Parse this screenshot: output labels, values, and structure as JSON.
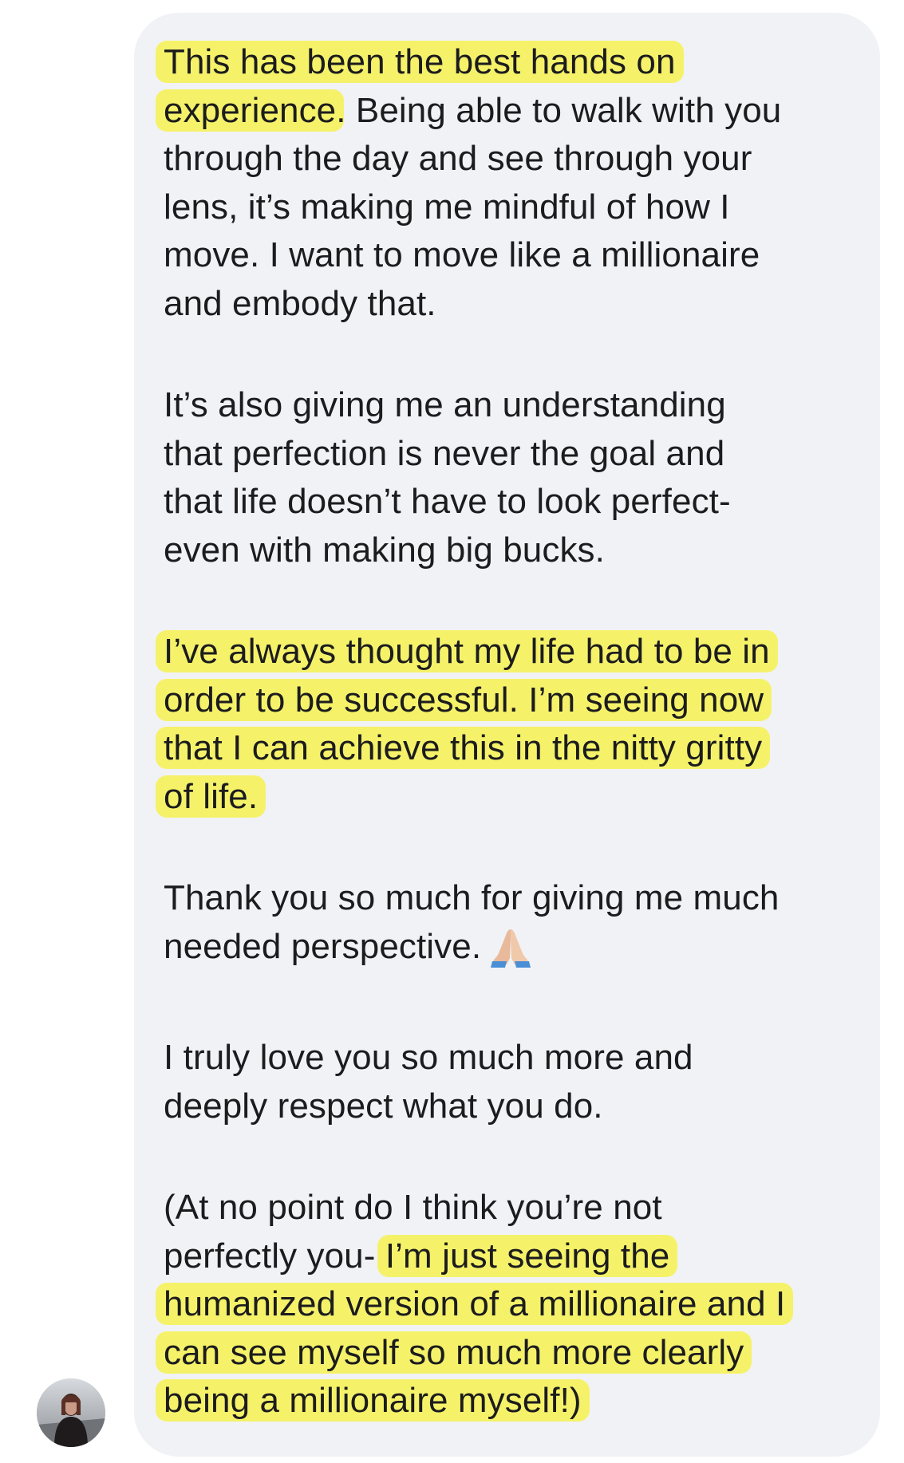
{
  "conversation": {
    "message": {
      "paragraphs": [
        {
          "lines": [
            {
              "segments": [
                {
                  "text": "This has been the best hands on",
                  "highlight": true
                }
              ]
            },
            {
              "segments": [
                {
                  "text": "experience",
                  "highlight": true
                },
                {
                  "text": ". Being able to walk with you",
                  "highlight": false
                }
              ]
            },
            {
              "segments": [
                {
                  "text": "through the day and see through your",
                  "highlight": false
                }
              ]
            },
            {
              "segments": [
                {
                  "text": "lens, it’s making me mindful of how I",
                  "highlight": false
                }
              ]
            },
            {
              "segments": [
                {
                  "text": "move. I want to move like a millionaire",
                  "highlight": false
                }
              ]
            },
            {
              "segments": [
                {
                  "text": "and embody that.",
                  "highlight": false
                }
              ]
            }
          ]
        },
        {
          "lines": [
            {
              "segments": [
                {
                  "text": "It’s also giving me an understanding",
                  "highlight": false
                }
              ]
            },
            {
              "segments": [
                {
                  "text": "that perfection is never the goal and",
                  "highlight": false
                }
              ]
            },
            {
              "segments": [
                {
                  "text": "that life doesn’t have to look perfect-",
                  "highlight": false
                }
              ]
            },
            {
              "segments": [
                {
                  "text": "even with making big bucks.",
                  "highlight": false
                }
              ]
            }
          ]
        },
        {
          "lines": [
            {
              "segments": [
                {
                  "text": "I’ve always thought my life had to be in",
                  "highlight": true
                }
              ]
            },
            {
              "segments": [
                {
                  "text": "order to be successful. I’m seeing now",
                  "highlight": true
                }
              ]
            },
            {
              "segments": [
                {
                  "text": "that I can achieve this in the nitty gritty",
                  "highlight": true
                }
              ]
            },
            {
              "segments": [
                {
                  "text": "of life.",
                  "highlight": true
                }
              ]
            }
          ]
        },
        {
          "lines": [
            {
              "segments": [
                {
                  "text": "Thank you so much for giving me much",
                  "highlight": false
                }
              ]
            },
            {
              "segments": [
                {
                  "text": "needed perspective.",
                  "highlight": false
                }
              ],
              "emoji": "folded-hands-icon"
            }
          ]
        },
        {
          "lines": [
            {
              "segments": [
                {
                  "text": "I truly love you so much more and",
                  "highlight": false
                }
              ]
            },
            {
              "segments": [
                {
                  "text": "deeply respect what you do.",
                  "highlight": false
                }
              ]
            }
          ]
        },
        {
          "lines": [
            {
              "segments": [
                {
                  "text": "(At no point do I think you’re not",
                  "highlight": false
                }
              ]
            },
            {
              "segments": [
                {
                  "text": "perfectly you- ",
                  "highlight": false
                },
                {
                  "text": "I’m just seeing the",
                  "highlight": true
                }
              ]
            },
            {
              "segments": [
                {
                  "text": "humanized version of a millionaire and I",
                  "highlight": true
                }
              ]
            },
            {
              "segments": [
                {
                  "text": "can see myself so much more clearly",
                  "highlight": true
                }
              ]
            },
            {
              "segments": [
                {
                  "text": "being a millionaire myself!)",
                  "highlight": true
                }
              ]
            }
          ]
        }
      ]
    },
    "colors": {
      "bubble": "#f1f2f6",
      "text": "#1c1c1e",
      "highlight": "#f5f26a"
    },
    "avatar_icon": "user-avatar-photo"
  }
}
